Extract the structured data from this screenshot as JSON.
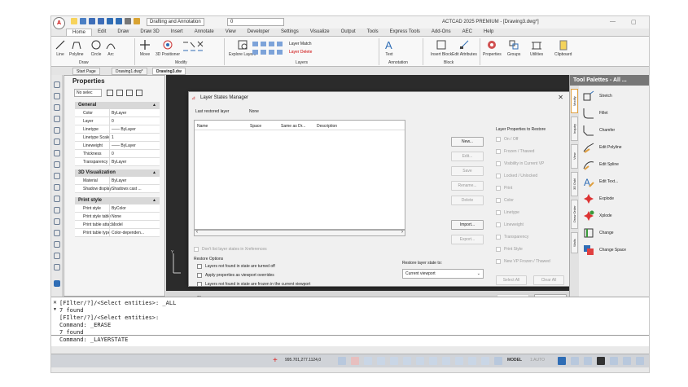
{
  "app": {
    "title": "ACTCAD 2025 PREMIUM - [Drawing3.dwg*]",
    "logo": "A",
    "workspace": "Drafting and Annotation",
    "layer_selector": "0",
    "min": "—",
    "max": "▢"
  },
  "menu_tabs": [
    "Home",
    "Edit",
    "Draw",
    "Draw 3D",
    "Insert",
    "Annotate",
    "View",
    "Developer",
    "Settings",
    "Visualize",
    "Output",
    "Tools",
    "Express Tools",
    "Add-Ons",
    "AEC",
    "Help"
  ],
  "ribbon": {
    "draw_tools": [
      "Line",
      "Polyline",
      "Circle",
      "Arc"
    ],
    "draw_group": "Draw",
    "modify_tools": [
      "Move",
      "3D Positioner"
    ],
    "modify_group": "Modify",
    "layers_tools": [
      "Explore Layers"
    ],
    "layer_match": "Layer Match",
    "layer_delete": "Layer Delete",
    "layers_group": "Layers",
    "annotation_tools": [
      "Text"
    ],
    "annotation_group": "Annotation",
    "block_tools": [
      "Insert Block",
      "Edit Attributes"
    ],
    "block_group": "Block",
    "right_tools": [
      "Properties",
      "Groups",
      "Utilities",
      "Clipboard"
    ]
  },
  "doc_tabs": [
    "Start Page",
    "Drawing1.dwg*",
    "Drawing3.dw"
  ],
  "properties": {
    "title": "Properties",
    "selection": "No selec",
    "sections": [
      {
        "name": "General",
        "rows": [
          {
            "name": "Color",
            "value": "ByLayer"
          },
          {
            "name": "Layer",
            "value": "0"
          },
          {
            "name": "Linetype",
            "value": "—— ByLayer"
          },
          {
            "name": "Linetype Scale",
            "value": "1"
          },
          {
            "name": "Lineweight",
            "value": "—— ByLayer"
          },
          {
            "name": "Thickness",
            "value": "0"
          },
          {
            "name": "Transparency",
            "value": "ByLayer"
          }
        ]
      },
      {
        "name": "3D Visualization",
        "rows": [
          {
            "name": "Material",
            "value": "ByLayer"
          },
          {
            "name": "Shadow display",
            "value": "Shadows cast ..."
          }
        ]
      },
      {
        "name": "Print style",
        "rows": [
          {
            "name": "Print style",
            "value": "ByColor"
          },
          {
            "name": "Print style table",
            "value": "None"
          },
          {
            "name": "Print table attac...",
            "value": "Model"
          },
          {
            "name": "Print table type",
            "value": "Color-dependen..."
          }
        ]
      }
    ]
  },
  "dialog": {
    "title": "Layer States Manager",
    "close": "✕",
    "last_restored_label": "Last restored layer",
    "last_restored_value": "None",
    "columns": [
      "Name",
      "Space",
      "Same as Dr...",
      "Description"
    ],
    "buttons": {
      "new": "New...",
      "edit": "Edit...",
      "save": "Save",
      "rename": "Rename...",
      "delete": "Delete",
      "import": "Import...",
      "export": "Export...",
      "select_all": "Select All",
      "clear_all": "Clear All",
      "restore": "Restore",
      "close": "Close"
    },
    "dont_list_xref": "Don't list layer states in Xreferences",
    "restore_options_label": "Restore Options",
    "restore_options": [
      "Layers not found in state are turned off",
      "Apply properties as viewport overrides",
      "Layers not found in state are frozen in the current viewport"
    ],
    "restore_to_label": "Restore layer state to:",
    "restore_to_value": "Current viewport",
    "props_to_restore_label": "Layer Properties to Restore",
    "props_to_restore": [
      "On / Off",
      "Frozen / Thawed",
      "Visibility in Current VP",
      "Locked / Unlocked",
      "Print",
      "Color",
      "Linetype",
      "Lineweight",
      "Transparency",
      "Print Style",
      "New VP Frozen / Thawed"
    ],
    "help": "?"
  },
  "palette": {
    "title": "Tool Palettes - All ...",
    "vtabs": [
      "Modify",
      "Inquiry",
      "View",
      "3D Dsbl",
      "Draw Order",
      "Walls"
    ],
    "tools": [
      "Stretch",
      "Fillet",
      "Chamfer",
      "Edit Polyline",
      "Edit Spline",
      "Edit Text...",
      "Explode",
      "Xplode",
      "Change",
      "Change Space"
    ]
  },
  "command": {
    "history": [
      "[FIlter/?]/<Select entities>: _ALL",
      "7 found",
      "[FIlter/?]/<Select entities>:",
      "Command: _ERASE",
      "7 found"
    ],
    "input": "Command: _LAYERSTATE"
  },
  "status": {
    "coords": "995.701,277.1124,0",
    "model": "MODEL",
    "scale": "1:AUTO"
  },
  "colors": {
    "accent": "#2f6db5",
    "drawing_bg": "#2b2b2b",
    "palette_title": "#777777"
  }
}
